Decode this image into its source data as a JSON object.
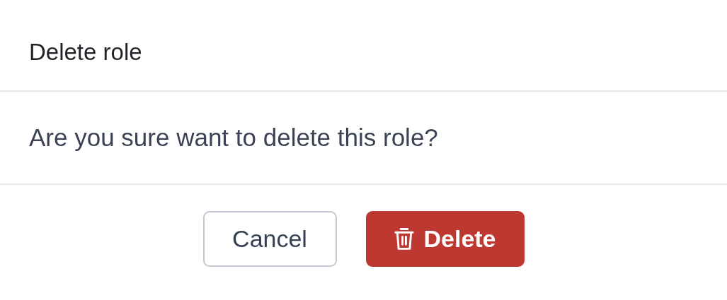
{
  "dialog": {
    "title": "Delete role",
    "message": "Are you sure want to delete this role?",
    "buttons": [
      {
        "label": "Cancel",
        "kind": "secondary"
      },
      {
        "label": "Delete",
        "kind": "danger"
      }
    ]
  }
}
